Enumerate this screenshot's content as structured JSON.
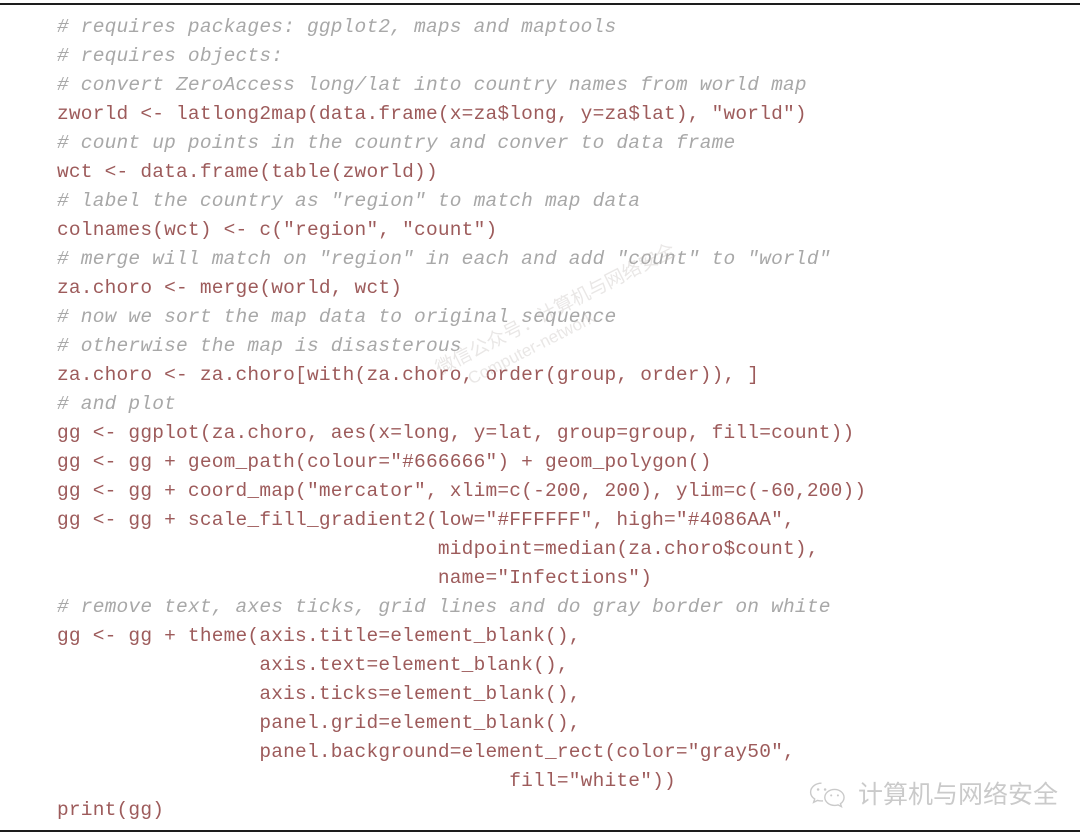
{
  "document": {
    "language": "R",
    "title": "ggplot2 world choropleth code listing",
    "colors": {
      "background": "#ffffff",
      "code_text": "#9d5b5b",
      "comment_text": "#a8a8a8",
      "rule": "#1d1d1d",
      "watermark": "#b9b1ad"
    }
  },
  "code": {
    "lines": [
      {
        "kind": "comment",
        "text": "# requires packages: ggplot2, maps and maptools"
      },
      {
        "kind": "comment",
        "text": "# requires objects:"
      },
      {
        "kind": "comment",
        "text": "# convert ZeroAccess long/lat into country names from world map"
      },
      {
        "kind": "code",
        "text": "zworld <- latlong2map(data.frame(x=za$long, y=za$lat), \"world\")"
      },
      {
        "kind": "comment",
        "text": "# count up points in the country and conver to data frame"
      },
      {
        "kind": "code",
        "text": "wct <- data.frame(table(zworld))"
      },
      {
        "kind": "comment",
        "text": "# label the country as \"region\" to match map data"
      },
      {
        "kind": "code",
        "text": "colnames(wct) <- c(\"region\", \"count\")"
      },
      {
        "kind": "comment",
        "text": "# merge will match on \"region\" in each and add \"count\" to \"world\""
      },
      {
        "kind": "code",
        "text": "za.choro <- merge(world, wct)"
      },
      {
        "kind": "comment",
        "text": "# now we sort the map data to original sequence"
      },
      {
        "kind": "comment",
        "text": "# otherwise the map is disasterous"
      },
      {
        "kind": "code",
        "text": "za.choro <- za.choro[with(za.choro, order(group, order)), ]"
      },
      {
        "kind": "comment",
        "text": "# and plot"
      },
      {
        "kind": "code",
        "text": "gg <- ggplot(za.choro, aes(x=long, y=lat, group=group, fill=count))"
      },
      {
        "kind": "code",
        "text": "gg <- gg + geom_path(colour=\"#666666\") + geom_polygon()"
      },
      {
        "kind": "code",
        "text": "gg <- gg + coord_map(\"mercator\", xlim=c(-200, 200), ylim=c(-60,200))"
      },
      {
        "kind": "code",
        "text": "gg <- gg + scale_fill_gradient2(low=\"#FFFFFF\", high=\"#4086AA\","
      },
      {
        "kind": "code",
        "text": "                                midpoint=median(za.choro$count),"
      },
      {
        "kind": "code",
        "text": "                                name=\"Infections\")"
      },
      {
        "kind": "comment",
        "text": "# remove text, axes ticks, grid lines and do gray border on white"
      },
      {
        "kind": "code",
        "text": "gg <- gg + theme(axis.title=element_blank(),"
      },
      {
        "kind": "code",
        "text": "                 axis.text=element_blank(),"
      },
      {
        "kind": "code",
        "text": "                 axis.ticks=element_blank(),"
      },
      {
        "kind": "code",
        "text": "                 panel.grid=element_blank(),"
      },
      {
        "kind": "code",
        "text": "                 panel.background=element_rect(color=\"gray50\","
      },
      {
        "kind": "code",
        "text": "                                      fill=\"white\"))"
      },
      {
        "kind": "code",
        "text": "print(gg)"
      }
    ]
  },
  "watermarks": {
    "diagonal": {
      "line_cn": "微信公众号：计算机与网络安全",
      "line_en": "Computer-network"
    },
    "badge": {
      "icon": "wechat-icon",
      "label": "计算机与网络安全"
    }
  }
}
